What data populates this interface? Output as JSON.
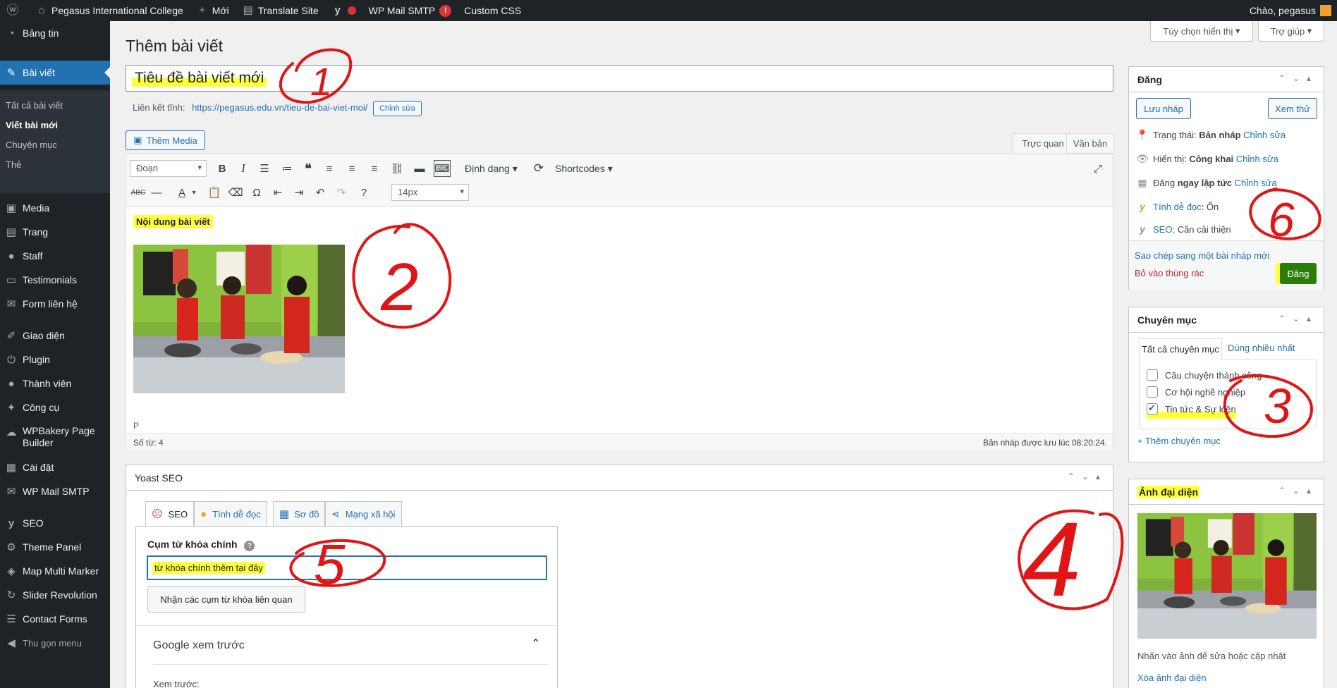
{
  "adminbar": {
    "site_name": "Pegasus International College",
    "new": "Mới",
    "translate": "Translate Site",
    "wp_mail": "WP Mail SMTP",
    "wp_mail_badge": "!",
    "custom_css": "Custom CSS",
    "greeting": "Chào, pegasus"
  },
  "sidebar": {
    "items": [
      {
        "label": "Bảng tin",
        "icon": "dashboard-icon"
      },
      {
        "label": "Bài viết",
        "icon": "pin-icon"
      },
      {
        "label": "Media",
        "icon": "media-icon"
      },
      {
        "label": "Trang",
        "icon": "page-icon"
      },
      {
        "label": "Staff",
        "icon": "user-icon"
      },
      {
        "label": "Testimonials",
        "icon": "quote-icon"
      },
      {
        "label": "Form liên hệ",
        "icon": "mail-icon"
      },
      {
        "label": "Giao diện",
        "icon": "brush-icon"
      },
      {
        "label": "Plugin",
        "icon": "plugin-icon"
      },
      {
        "label": "Thành viên",
        "icon": "users-icon"
      },
      {
        "label": "Công cụ",
        "icon": "wrench-icon"
      },
      {
        "label": "WPBakery Page Builder",
        "icon": "cloud-icon"
      },
      {
        "label": "Cài đặt",
        "icon": "settings-icon"
      },
      {
        "label": "WP Mail SMTP",
        "icon": "mail-icon"
      },
      {
        "label": "SEO",
        "icon": "yoast-icon"
      },
      {
        "label": "Theme Panel",
        "icon": "gear-icon"
      },
      {
        "label": "Map Multi Marker",
        "icon": "map-icon"
      },
      {
        "label": "Slider Revolution",
        "icon": "refresh-icon"
      },
      {
        "label": "Contact Forms",
        "icon": "form-icon"
      },
      {
        "label": "Thu gọn menu",
        "icon": "collapse-icon"
      }
    ],
    "submenu": [
      "Tất cả bài viết",
      "Viết bài mới",
      "Chuyên mục",
      "Thẻ"
    ]
  },
  "header": {
    "title": "Thêm bài viết",
    "screen_options": "Tùy chọn hiển thị",
    "help": "Trợ giúp"
  },
  "post": {
    "title": "Tiêu đề bài viết mới",
    "permalink_label": "Liên kết tĩnh:",
    "permalink_url": "https://pegasus.edu.vn/tieu-de-bai-viet-moi/",
    "permalink_edit": "Chỉnh sửa",
    "add_media": "Thêm Media",
    "tab_visual": "Trực quan",
    "tab_text": "Văn bản"
  },
  "toolbar": {
    "format_select": "Đoạn",
    "formats_menu": "Định dạng",
    "shortcodes": "Shortcodes",
    "font_size": "14px"
  },
  "content": {
    "text": "Nội dung bài viết",
    "path": "P",
    "word_count": "Số từ: 4",
    "autosave": "Bản nháp được lưu lúc 08:20:24."
  },
  "publish": {
    "title": "Đăng",
    "save_draft": "Lưu nháp",
    "preview": "Xem thử",
    "status_label": "Trạng thái:",
    "status_value": "Bản nháp",
    "visibility_label": "Hiển thị:",
    "visibility_value": "Công khai",
    "schedule_label": "Đăng",
    "schedule_value": "ngay lập tức",
    "edit": "Chỉnh sửa",
    "readability_label": "Tính dễ đọc",
    "readability_value": ": Ổn",
    "seo_label": "SEO",
    "seo_value": ": Cần cải thiện",
    "copy_draft": "Sao chép sang một bài nháp mới",
    "trash": "Bỏ vào thùng rác",
    "publish_button": "Đăng"
  },
  "categories": {
    "title": "Chuyên mục",
    "tab_all": "Tất cả chuyên mục",
    "tab_popular": "Dùng nhiều nhất",
    "items": [
      {
        "label": "Câu chuyện thành công",
        "checked": false
      },
      {
        "label": "Cơ hội nghề nghiệp",
        "checked": false
      },
      {
        "label": "Tin tức & Sự kiện",
        "checked": true
      }
    ],
    "add_new": "+ Thêm chuyên mục"
  },
  "featured": {
    "title": "Ảnh đại diện",
    "hint": "Nhấn vào ảnh để sửa hoặc cập nhật",
    "remove": "Xóa ảnh đại diện"
  },
  "yoast": {
    "title": "Yoast SEO",
    "tabs": [
      "SEO",
      "Tính dễ đọc",
      "Sơ đồ",
      "Mạng xã hội"
    ],
    "focus_label": "Cụm từ khóa chính",
    "focus_value": "từ khóa chính thêm tại đây",
    "related_button": "Nhận các cụm từ khóa liên quan",
    "google_preview": "Google xem trước",
    "preview_as": "Xem trước:"
  },
  "annotations": [
    "1",
    "2",
    "3",
    "4",
    "5",
    "6"
  ],
  "colors": {
    "accent": "#2271b1",
    "adminbar": "#1d2327",
    "highlight": "#ffff3a",
    "annotation": "#e01616",
    "publish": "#2a7d0b"
  }
}
